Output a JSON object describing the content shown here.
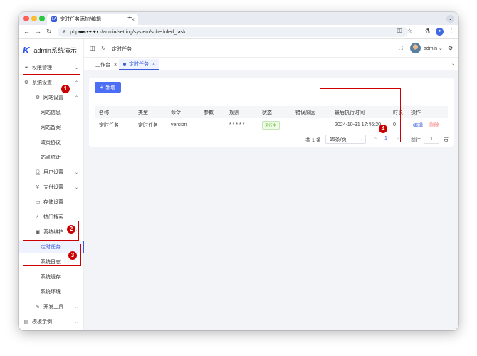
{
  "browser": {
    "tab_title": "定时任务添加/编辑",
    "favicon_text": "LA",
    "url": "php▪■▪·•✦✦▪ r/admin/setting/system/scheduled_task",
    "new_tab": "+",
    "close": "×"
  },
  "app": {
    "logo_text": "admin系统演示",
    "sidebar": {
      "items": [
        {
          "label": "权限管理",
          "icon": "lock-icon",
          "level": 1,
          "chevron": "⌄"
        },
        {
          "label": "系统设置",
          "icon": "gear-icon",
          "level": 1,
          "chevron": "⌃"
        },
        {
          "label": "网站设置",
          "icon": "gear-icon",
          "level": 2,
          "chevron": "⌃"
        },
        {
          "label": "网站信息",
          "level": 3
        },
        {
          "label": "网站备案",
          "level": 3
        },
        {
          "label": "政策协议",
          "level": 3
        },
        {
          "label": "站点统计",
          "level": 3
        },
        {
          "label": "用户设置",
          "icon": "user-icon",
          "level": 2,
          "chevron": "⌄"
        },
        {
          "label": "支付设置",
          "icon": "pay-icon",
          "level": 2,
          "chevron": "⌄"
        },
        {
          "label": "存储设置",
          "icon": "folder-icon",
          "level": 2
        },
        {
          "label": "热门搜索",
          "icon": "search-icon",
          "level": 2
        },
        {
          "label": "系统维护",
          "icon": "maintain-icon",
          "level": 2,
          "chevron": "⌃"
        },
        {
          "label": "定时任务",
          "level": 3,
          "active": true
        },
        {
          "label": "系统日志",
          "level": 3
        },
        {
          "label": "系统缓存",
          "level": 3
        },
        {
          "label": "系统环境",
          "level": 3
        },
        {
          "label": "开发工具",
          "icon": "tool-icon",
          "level": 2,
          "chevron": "⌄"
        },
        {
          "label": "模板示例",
          "icon": "template-icon",
          "level": 1,
          "chevron": "⌄"
        }
      ]
    },
    "topbar": {
      "breadcrumb": "定时任务",
      "user": "admin ⌄"
    },
    "tabs": [
      {
        "label": "工作台"
      },
      {
        "label": "定时任务",
        "active": true
      }
    ],
    "add_button": "新增",
    "table": {
      "headers": [
        "名称",
        "类型",
        "命令",
        "参数",
        "规则",
        "状态",
        "错误原因",
        "最后执行时间",
        "时长",
        "操作"
      ],
      "rows": [
        {
          "name": "定时任务",
          "type": "定时任务",
          "command": "version",
          "params": "",
          "rule": "* * * * *",
          "status": "运行中",
          "error": "",
          "last_run": "2024-10-31 17:46:20",
          "duration": "0",
          "edit": "编辑",
          "delete": "删除"
        }
      ]
    },
    "pagination": {
      "total": "共 1 条",
      "page_size": "15条/页",
      "prev": "<",
      "current": "1",
      "next": ">",
      "goto_label": "前往",
      "goto_value": "1",
      "unit": "页"
    }
  },
  "annotations": {
    "badges": [
      "1",
      "2",
      "3",
      "4"
    ],
    "color": "#cc0000"
  }
}
